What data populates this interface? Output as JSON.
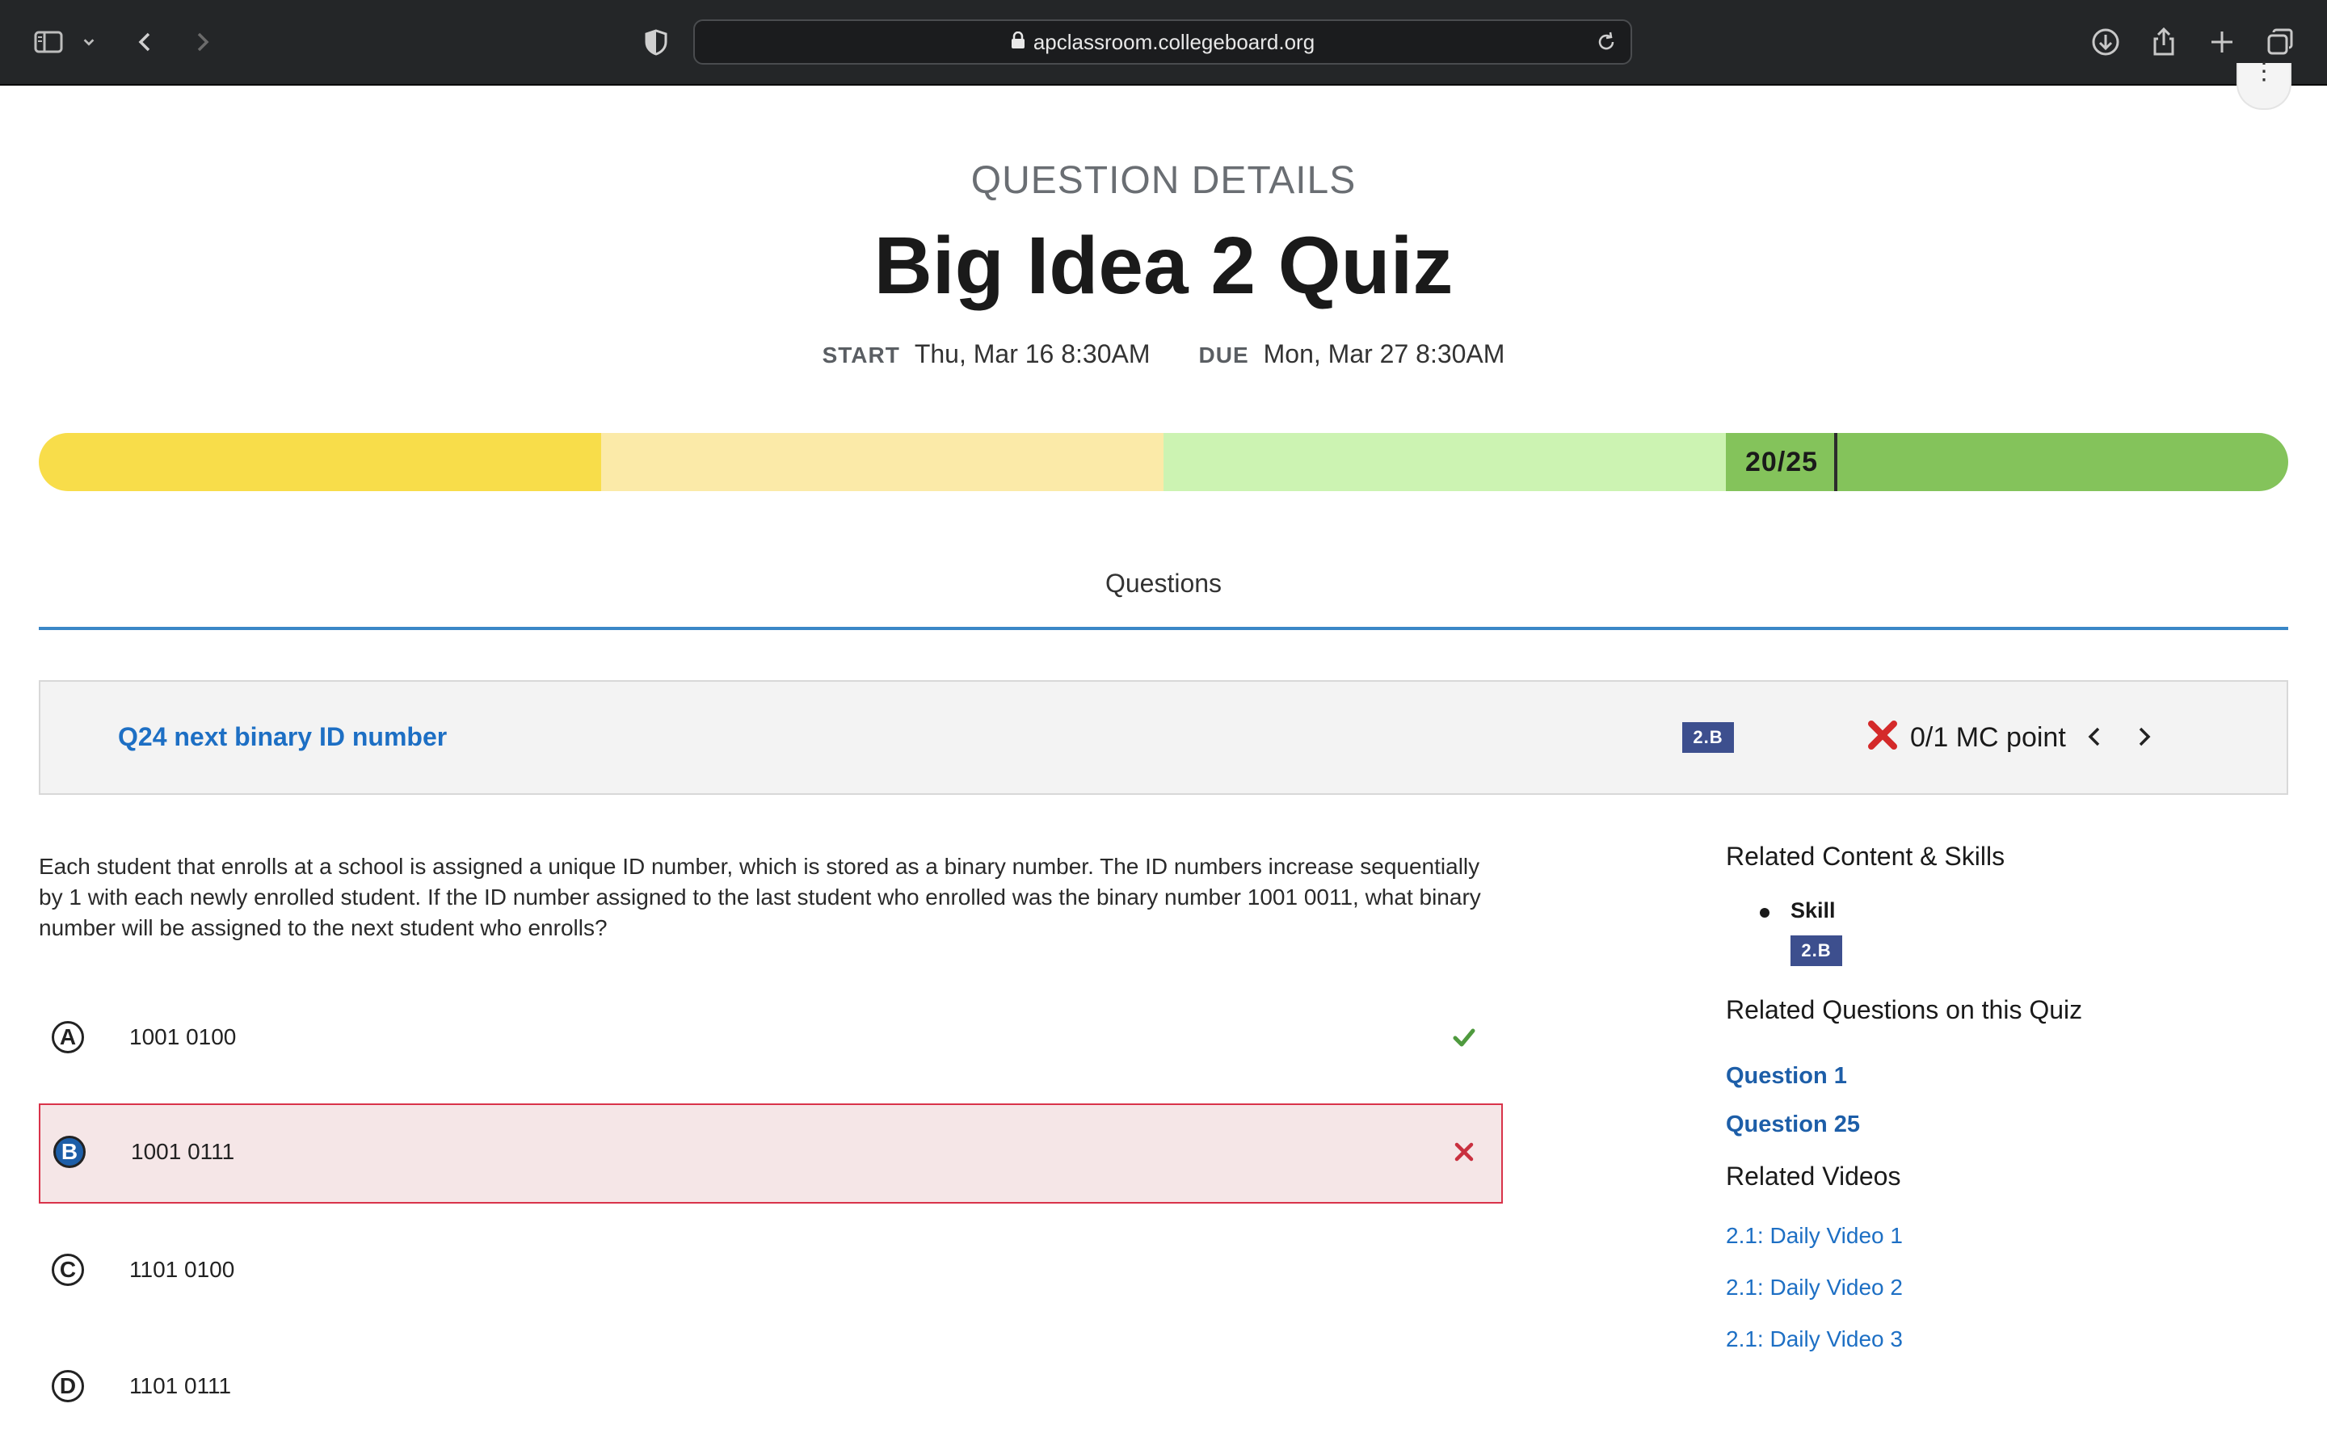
{
  "browser": {
    "url": "apclassroom.collegeboard.org"
  },
  "header": {
    "eyebrow": "QUESTION DETAILS",
    "title": "Big Idea 2 Quiz",
    "start_label": "START",
    "start_value": "Thu, Mar 16 8:30AM",
    "due_label": "DUE",
    "due_value": "Mon, Mar 27 8:30AM"
  },
  "score": {
    "text": "20/25",
    "earned": 20,
    "total": 25,
    "band_colors": [
      "#f8dd4a",
      "#fbeaa8",
      "#ccf3b2",
      "#84c35b"
    ]
  },
  "tabs": {
    "active": "Questions"
  },
  "question": {
    "title": "Q24 next binary ID number",
    "skill_badge": "2.B",
    "points": "0/1 MC point",
    "stem": "Each student that enrolls at a school is assigned a unique ID number, which is stored as a binary number. The ID numbers increase sequentially by 1 with each newly enrolled student. If the ID number assigned to the last student who enrolled was the binary number 1001 0011, what binary number will be assigned to the next student who enrolls?",
    "choices": [
      {
        "letter": "A",
        "text": "1001 0100",
        "mark": "check-icon"
      },
      {
        "letter": "B",
        "text": "1001 0111",
        "mark": "x-icon"
      },
      {
        "letter": "C",
        "text": "1101 0100",
        "mark": ""
      },
      {
        "letter": "D",
        "text": "1101 0111",
        "mark": ""
      }
    ]
  },
  "sidebar": {
    "related_content_heading": "Related Content & Skills",
    "skill_label": "Skill",
    "skill_badge": "2.B",
    "related_questions_heading": "Related Questions on this Quiz",
    "related_questions": [
      "Question 1",
      "Question 25"
    ],
    "related_videos_heading": "Related Videos",
    "related_videos": [
      "2.1: Daily Video 1",
      "2.1: Daily Video 2",
      "2.1: Daily Video 3"
    ]
  }
}
